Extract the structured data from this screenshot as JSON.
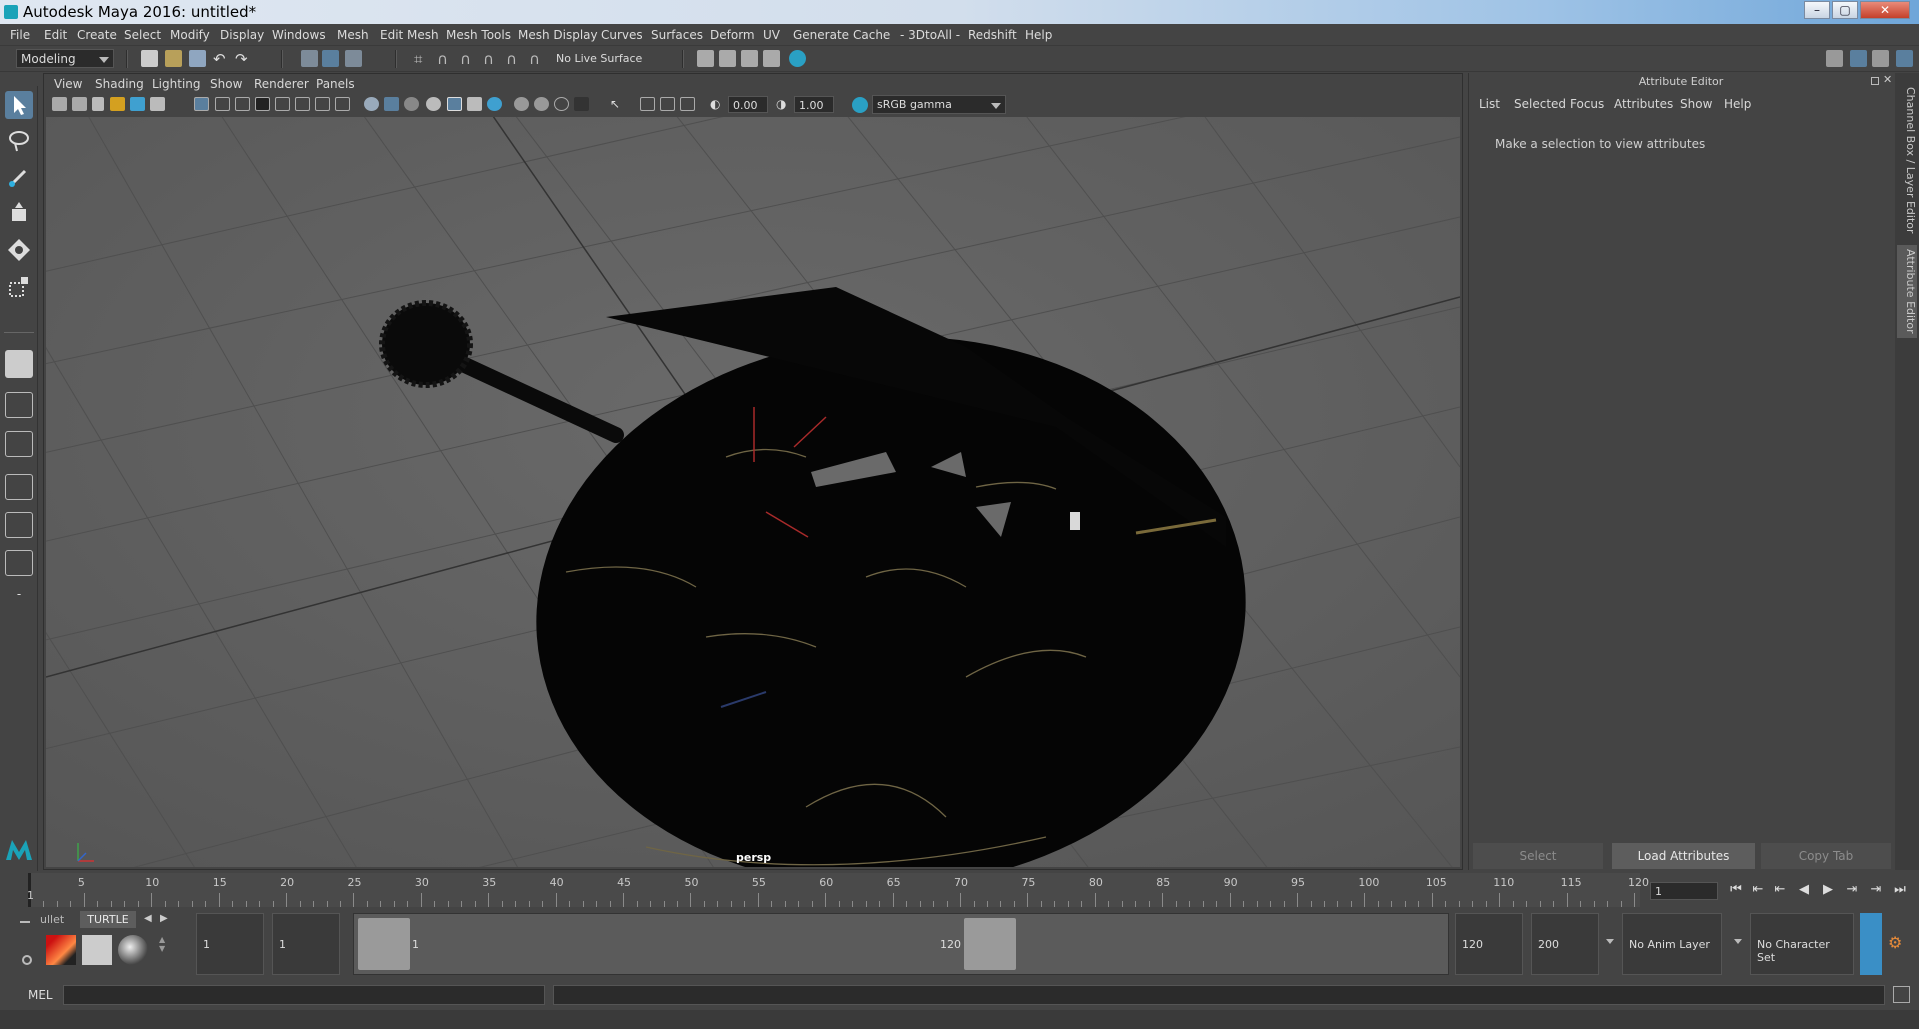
{
  "window": {
    "title": "Autodesk Maya 2016: untitled*"
  },
  "menubar": [
    "File",
    "Edit",
    "Create",
    "Select",
    "Modify",
    "Display",
    "Windows",
    "Mesh",
    "Edit Mesh",
    "Mesh Tools",
    "Mesh Display",
    "Curves",
    "Surfaces",
    "Deform",
    "UV",
    "Generate",
    "Cache",
    "- 3DtoAll -",
    "Redshift",
    "Help"
  ],
  "toolbar": {
    "mode": "Modeling",
    "live_surface": "No Live Surface"
  },
  "panel": {
    "menu": [
      "View",
      "Shading",
      "Lighting",
      "Show",
      "Renderer",
      "Panels"
    ],
    "exposure": "0.00",
    "gamma": "1.00",
    "color_space": "sRGB gamma",
    "camera": "persp"
  },
  "attribute_editor": {
    "title": "Attribute Editor",
    "menu": [
      "List",
      "Selected",
      "Focus",
      "Attributes",
      "Show",
      "Help"
    ],
    "message": "Make a selection to view attributes",
    "buttons": {
      "select": "Select",
      "load": "Load Attributes",
      "copy": "Copy Tab"
    }
  },
  "side_tabs": {
    "channel_box": "Channel Box / Layer Editor",
    "attr_editor": "Attribute Editor"
  },
  "timeline": {
    "start": 1,
    "end": 120,
    "labels": [
      "5",
      "10",
      "15",
      "20",
      "25",
      "30",
      "35",
      "40",
      "45",
      "50",
      "55",
      "60",
      "65",
      "70",
      "75",
      "80",
      "85",
      "90",
      "95",
      "100",
      "105",
      "110",
      "115",
      "120"
    ],
    "start_label": "1",
    "current_frame": "1"
  },
  "range": {
    "shelf_tabs": [
      "ullet",
      "TURTLE"
    ],
    "start_field": "1",
    "playback_start": "1",
    "range_start": "1",
    "range_end": "120",
    "playback_end": "120",
    "anim_end": "200",
    "anim_layer": "No Anim Layer",
    "character_set": "No Character Set"
  },
  "cmdline": {
    "label": "MEL"
  },
  "colors": {
    "active_tool": "#5a7f9e",
    "viewport_bg": "#606060",
    "maya_teal": "#1aa3b8"
  }
}
